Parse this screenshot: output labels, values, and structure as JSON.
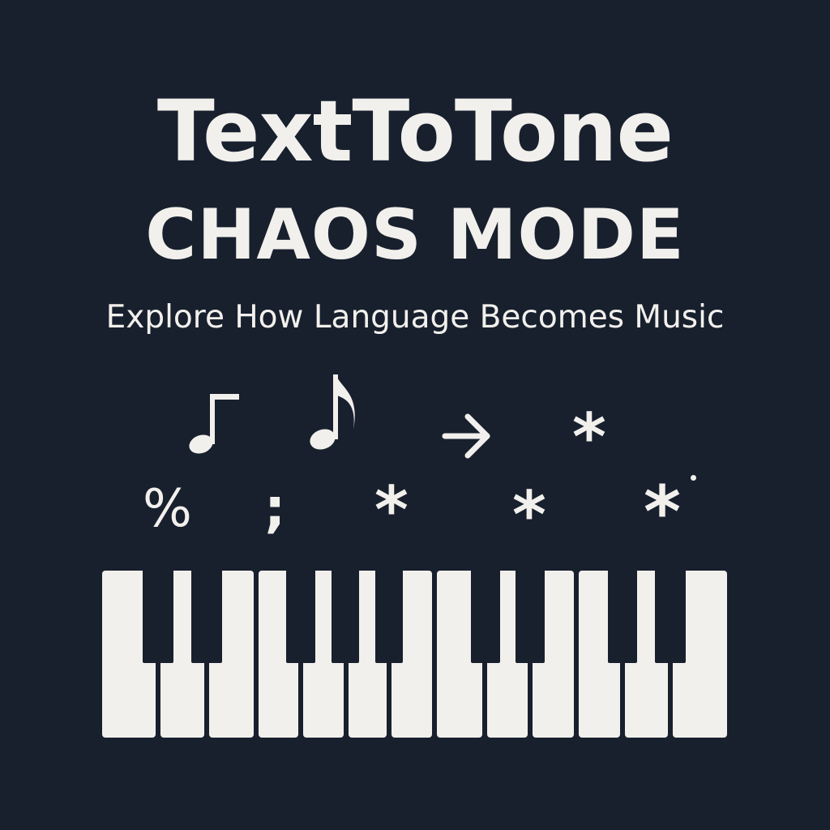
{
  "header": {
    "app_name": "TextToTone",
    "mode_label": "CHAOS MODE",
    "tagline": "Explore How Language Becomes Music"
  },
  "symbols": {
    "percent": "%",
    "semicolon": ";",
    "asterisk": "*"
  },
  "icons": [
    "eighth-note-flag-icon",
    "eighth-note-icon",
    "arrow-right-icon",
    "asterisk-icon"
  ],
  "colors": {
    "background": "#18202e",
    "foreground": "#f2f0ec"
  },
  "keyboard": {
    "white_key_count": 13,
    "black_key_count": 9
  }
}
